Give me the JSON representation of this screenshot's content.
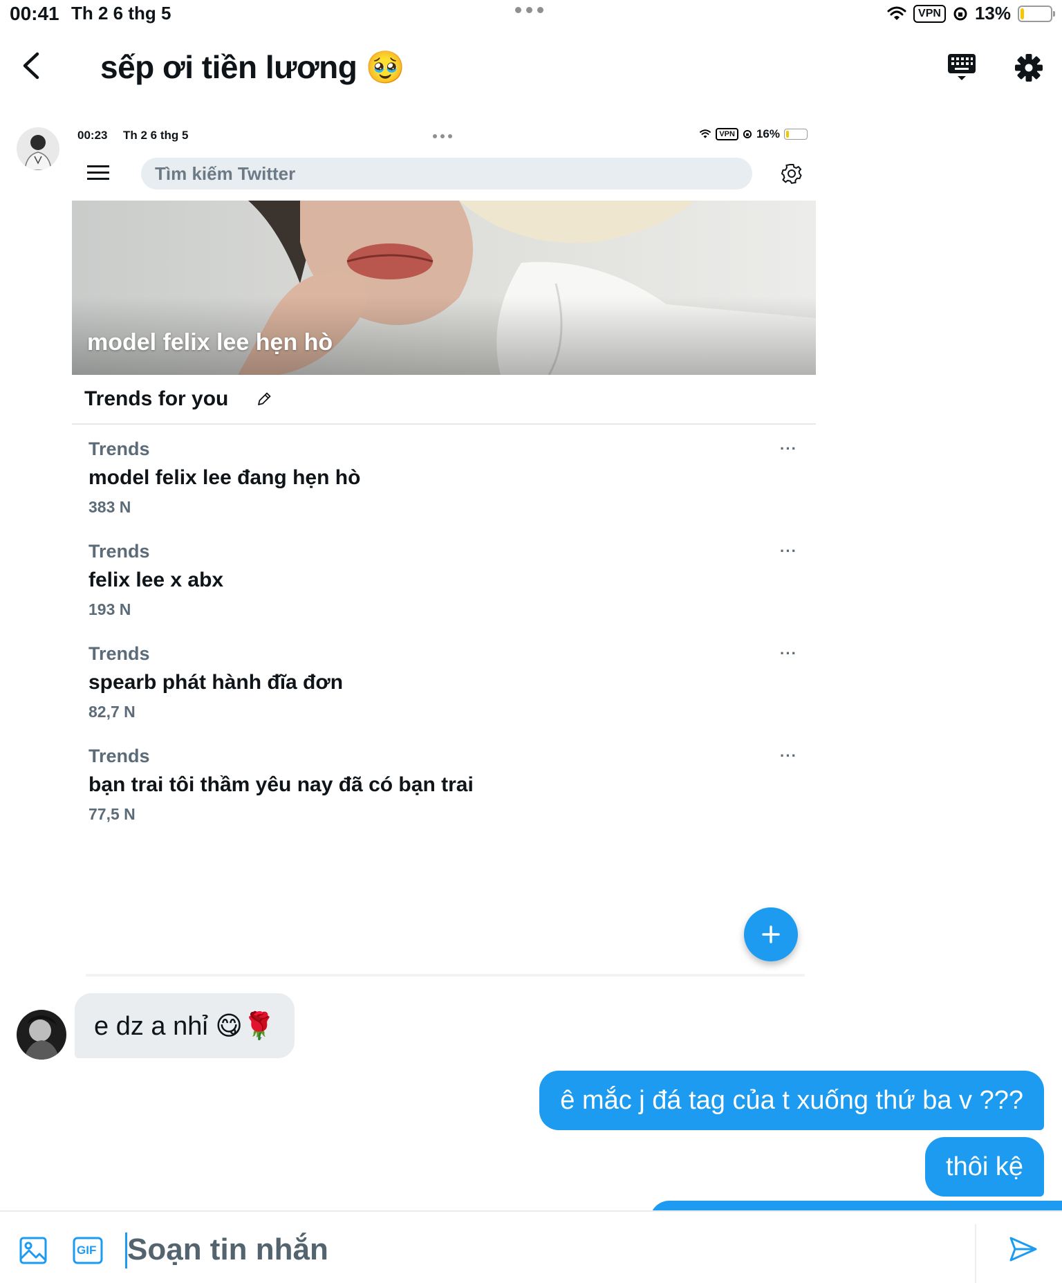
{
  "status_bar": {
    "time": "00:41",
    "date": "Th 2 6 thg 5",
    "vpn": "VPN",
    "battery": "13%",
    "battery_level": 0.13
  },
  "header": {
    "title": "sếp ơi tiền lương 🥹"
  },
  "shared_screenshot": {
    "status_bar": {
      "time": "00:23",
      "date": "Th 2 6 thg 5",
      "vpn": "VPN",
      "battery": "16%",
      "battery_level": 0.16
    },
    "search_placeholder": "Tìm kiếm Twitter",
    "banner_text": "model felix lee hẹn hò",
    "trends_heading": "Trends for you",
    "trends": [
      {
        "category": "Trends",
        "name": "model felix lee đang hẹn hò",
        "count": "383 N",
        "more": "···"
      },
      {
        "category": "Trends",
        "name": "felix lee x abx",
        "count": "193 N",
        "more": "···"
      },
      {
        "category": "Trends",
        "name": "spearb phát hành đĩa đơn",
        "count": "82,7 N",
        "more": "···"
      },
      {
        "category": "Trends",
        "name": "bạn trai tôi thầm yêu nay đã có bạn trai",
        "count": "77,5 N",
        "more": "···"
      }
    ],
    "fab_label": "+"
  },
  "messages": [
    {
      "direction": "incoming",
      "text": "e dz a nhỉ 😋🌹"
    },
    {
      "direction": "outgoing",
      "text": "ê mắc j đá tag của t xuống thứ ba v ???"
    },
    {
      "direction": "outgoing",
      "text": "thôi kệ"
    }
  ],
  "composer": {
    "placeholder": "Soạn tin nhắn",
    "gif_label": "GIF"
  },
  "colors": {
    "accent": "#1d9bf0",
    "incoming_bubble": "#e9edf0",
    "muted_text": "#5b6b78"
  }
}
